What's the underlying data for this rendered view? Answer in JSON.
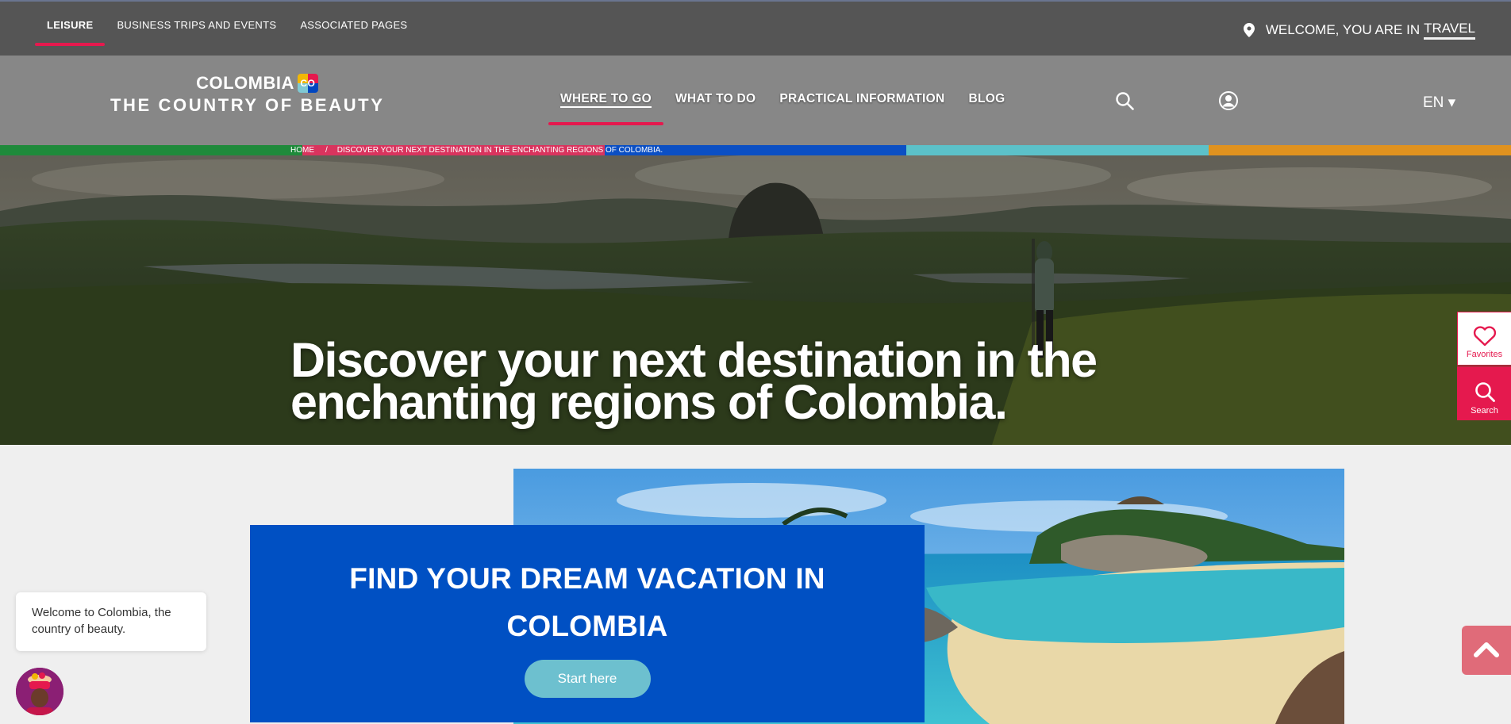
{
  "topbar": {
    "tabs": [
      {
        "label": "LEISURE"
      },
      {
        "label": "BUSINESS TRIPS AND EVENTS"
      },
      {
        "label": "ASSOCIATED PAGES"
      }
    ],
    "welcome_text": "WELCOME, YOU ARE IN",
    "welcome_highlight": "TRAVEL"
  },
  "logo": {
    "line1": "COLOMBIA",
    "badge": "CO",
    "line2": "THE COUNTRY OF BEAUTY"
  },
  "nav": {
    "links": [
      {
        "label": "WHERE TO GO"
      },
      {
        "label": "WHAT TO DO"
      },
      {
        "label": "PRACTICAL INFORMATION"
      },
      {
        "label": "BLOG"
      }
    ],
    "language": "EN ▾"
  },
  "breadcrumb": {
    "home": "HOME",
    "separator": "/",
    "current": "DISCOVER YOUR NEXT DESTINATION IN THE ENCHANTING REGIONS OF COLOMBIA."
  },
  "band_colors": [
    "#1f8a3b",
    "#d9345e",
    "#0b4fc4",
    "#5cc1c9",
    "#e0921f"
  ],
  "hero": {
    "title": "Discover your next destination in the enchanting regions of Colombia."
  },
  "side": {
    "favorites": "Favorites",
    "search": "Search"
  },
  "promo": {
    "title": "FIND YOUR DREAM VACATION IN COLOMBIA",
    "button": "Start here"
  },
  "chat": {
    "message": "Welcome to Colombia, the country of beauty."
  },
  "colors": {
    "accent": "#e5194e",
    "promo_blue": "#0050c3",
    "button_teal": "#6dc0cf"
  }
}
